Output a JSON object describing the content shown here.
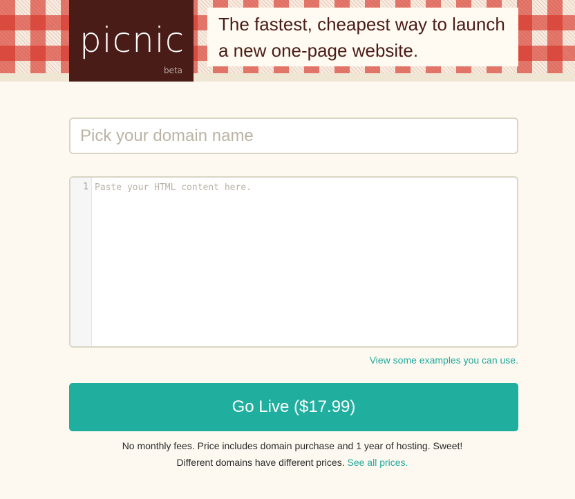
{
  "brand": {
    "name": "picnic",
    "badge": "beta"
  },
  "tagline": "The fastest, cheapest way to launch a new one-page website.",
  "domain": {
    "placeholder": "Pick your domain name",
    "value": ""
  },
  "editor": {
    "line_number": "1",
    "placeholder": "Paste your HTML content here."
  },
  "examples_link": "View some examples you can use.",
  "go_live_label": "Go Live ($17.99)",
  "fine_print": {
    "line1": "No monthly fees. Price includes domain purchase and 1 year of hosting. Sweet!",
    "line2": "Different domains have different prices.",
    "prices_link": "See all prices."
  },
  "colors": {
    "brand_dark": "#4a1c17",
    "accent": "#20ae9f",
    "link": "#1fa89c",
    "gingham_red": "#d63024",
    "page_bg": "#fdf9f0"
  }
}
